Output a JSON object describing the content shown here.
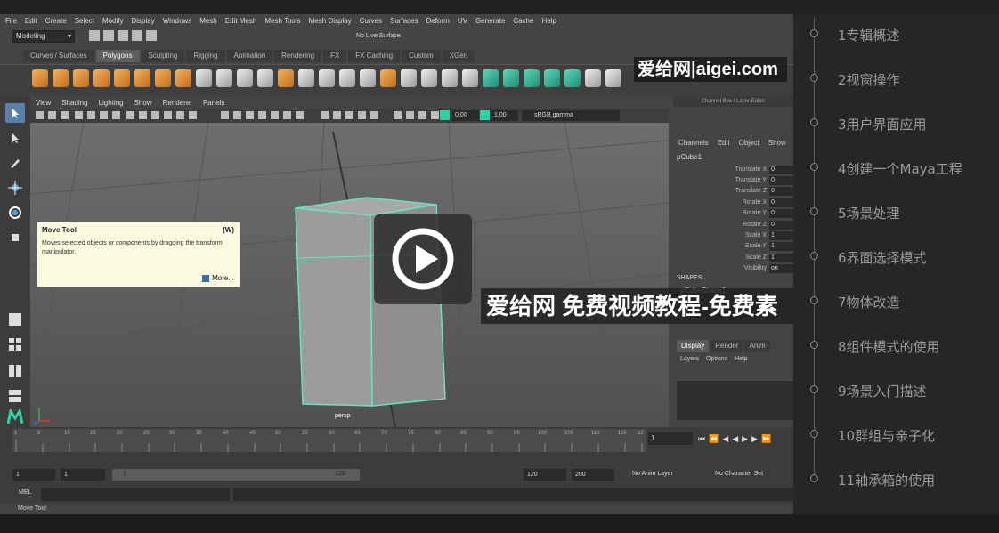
{
  "maya": {
    "menu": [
      "File",
      "Edit",
      "Create",
      "Select",
      "Modify",
      "Display",
      "Windows",
      "Mesh",
      "Edit Mesh",
      "Mesh Tools",
      "Mesh Display",
      "Curves",
      "Surfaces",
      "Deform",
      "UV",
      "Generate",
      "Cache",
      "Help"
    ],
    "mode_dropdown": "Modeling",
    "live_surface": "No Live Surface",
    "shelf_tabs": [
      "Curves / Surfaces",
      "Polygons",
      "Sculpting",
      "Rigging",
      "Animation",
      "Rendering",
      "FX",
      "FX Caching",
      "Custom",
      "XGen"
    ],
    "active_shelf_tab": "Polygons",
    "view_menu": [
      "View",
      "Shading",
      "Lighting",
      "Show",
      "Renderer",
      "Panels"
    ],
    "exposure_value": "0.00",
    "gamma_value": "1.00",
    "color_space": "sRGB gamma",
    "camera_label": "persp",
    "tooltip": {
      "title": "Move Tool",
      "shortcut": "(W)",
      "description": "Moves selected objects or components by dragging the transform manipulator.",
      "more": "More..."
    },
    "channel_box": {
      "header": "Channel Box / Layer Editor",
      "menu": [
        "Channels",
        "Edit",
        "Object",
        "Show"
      ],
      "object": "pCube1",
      "attributes": [
        {
          "name": "Translate X",
          "value": "0"
        },
        {
          "name": "Translate Y",
          "value": "0"
        },
        {
          "name": "Translate Z",
          "value": "0"
        },
        {
          "name": "Rotate X",
          "value": "0"
        },
        {
          "name": "Rotate Y",
          "value": "0"
        },
        {
          "name": "Rotate Z",
          "value": "0"
        },
        {
          "name": "Scale X",
          "value": "1"
        },
        {
          "name": "Scale Y",
          "value": "1"
        },
        {
          "name": "Scale Z",
          "value": "1"
        },
        {
          "name": "Visibility",
          "value": "on"
        }
      ],
      "shapes_label": "SHAPES",
      "shape_object": "pCubeShape1",
      "layer_tabs": [
        "Display",
        "Render",
        "Anim"
      ],
      "layer_menu": [
        "Layers",
        "Options",
        "Help"
      ]
    },
    "timeline": {
      "ticks": [
        "1",
        "5",
        "10",
        "15",
        "20",
        "25",
        "30",
        "35",
        "40",
        "45",
        "50",
        "55",
        "60",
        "65",
        "70",
        "75",
        "80",
        "85",
        "90",
        "95",
        "100",
        "105",
        "110",
        "115",
        "12"
      ],
      "current_frame": "1",
      "range_start": "1",
      "playback_start": "1",
      "slider_start": "1",
      "slider_end": "120",
      "playback_end": "120",
      "range_end": "200",
      "anim_layer": "No Anim Layer",
      "character_set": "No Character Set"
    },
    "mel_label": "MEL",
    "help_line": "Move Tool"
  },
  "overlay": {
    "watermark": "爱给网|aigei.com",
    "promo": "爱给网  免费视频教程-免费素"
  },
  "playlist": [
    "1专辑概述",
    "2视窗操作",
    "3用户界面应用",
    "4创建一个Maya工程",
    "5场景处理",
    "6界面选择模式",
    "7物体改造",
    "8组件模式的使用",
    "9场景入门描述",
    "10群组与亲子化",
    "11轴承箱的使用"
  ],
  "colors": {
    "accent_teal": "#2fd0a8",
    "cube_wire": "#67e3c6",
    "playlist_text": "#9a9a9a"
  }
}
